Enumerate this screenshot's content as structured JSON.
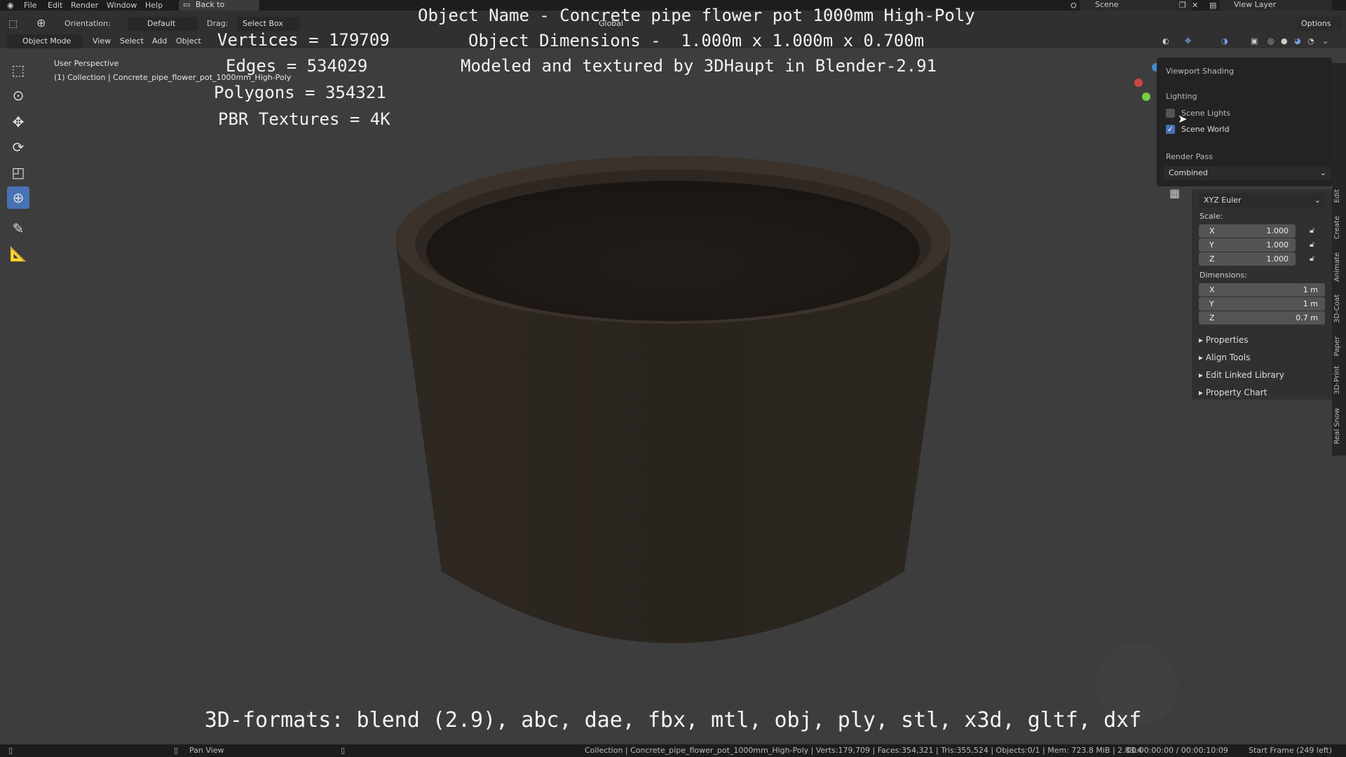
{
  "menu": {
    "items": [
      "File",
      "Edit",
      "Render",
      "Window",
      "Help"
    ],
    "back_label": "Back to Previous",
    "scene": "Scene",
    "view_layer": "View Layer"
  },
  "header": {
    "orientation_label": "Orientation:",
    "orientation_value": "Default",
    "drag_label": "Drag:",
    "drag_value": "Select Box",
    "transform_value": "Global",
    "options_label": "Options",
    "mode": "Object Mode",
    "menus": [
      "View",
      "Select",
      "Add",
      "Object"
    ]
  },
  "viewport": {
    "perspective": "User Perspective",
    "collection": "(1) Collection | Concrete_pipe_flower_pot_1000mm_High-Poly"
  },
  "overlay": {
    "vertices": "Vertices = 179709",
    "edges": "Edges = 534029",
    "polygons": "Polygons = 354321",
    "textures": "PBR Textures = 4K",
    "object_name": "Object Name - Concrete pipe flower pot 1000mm High-Poly",
    "dimensions": "Object Dimensions -  1.000m x 1.000m x 0.700m",
    "credit": "Modeled and textured by 3DHaupt in Blender-2.91",
    "formats": "3D-formats: blend (2.9), abc, dae, fbx, mtl, obj, ply, stl, x3d, gltf, dxf"
  },
  "shading_popover": {
    "title": "Viewport Shading",
    "lighting": "Lighting",
    "scene_lights": "Scene Lights",
    "scene_world": "Scene World",
    "render_pass": "Render Pass",
    "render_pass_value": "Combined"
  },
  "npanel": {
    "rotation_mode": "XYZ Euler",
    "scale_label": "Scale:",
    "scale": [
      {
        "axis": "X",
        "value": "1.000"
      },
      {
        "axis": "Y",
        "value": "1.000"
      },
      {
        "axis": "Z",
        "value": "1.000"
      }
    ],
    "dimensions_label": "Dimensions:",
    "dimensions": [
      {
        "axis": "X",
        "value": "1 m"
      },
      {
        "axis": "Y",
        "value": "1 m"
      },
      {
        "axis": "Z",
        "value": "0.7 m"
      }
    ],
    "sections": [
      "Properties",
      "Align Tools",
      "Edit Linked Library",
      "Property Chart"
    ],
    "tabs": [
      "Edit",
      "Create",
      "Animate",
      "3D-Coat",
      "Paper",
      "3D-Print",
      "Real Snow"
    ]
  },
  "status": {
    "pan": "Pan View",
    "info": "Collection | Concrete_pipe_flower_pot_1000mm_High-Poly | Verts:179,709 | Faces:354,321 | Tris:355,524 | Objects:0/1 | Mem: 723.8 MiB | 2.83.4",
    "time": "00:00:00:00 / 00:00:10:09",
    "frame": "Start Frame (249 left)"
  },
  "colors": {
    "accent": "#4772b3",
    "viewport_bg": "#3d3d3d",
    "pot": "#2a2420"
  }
}
